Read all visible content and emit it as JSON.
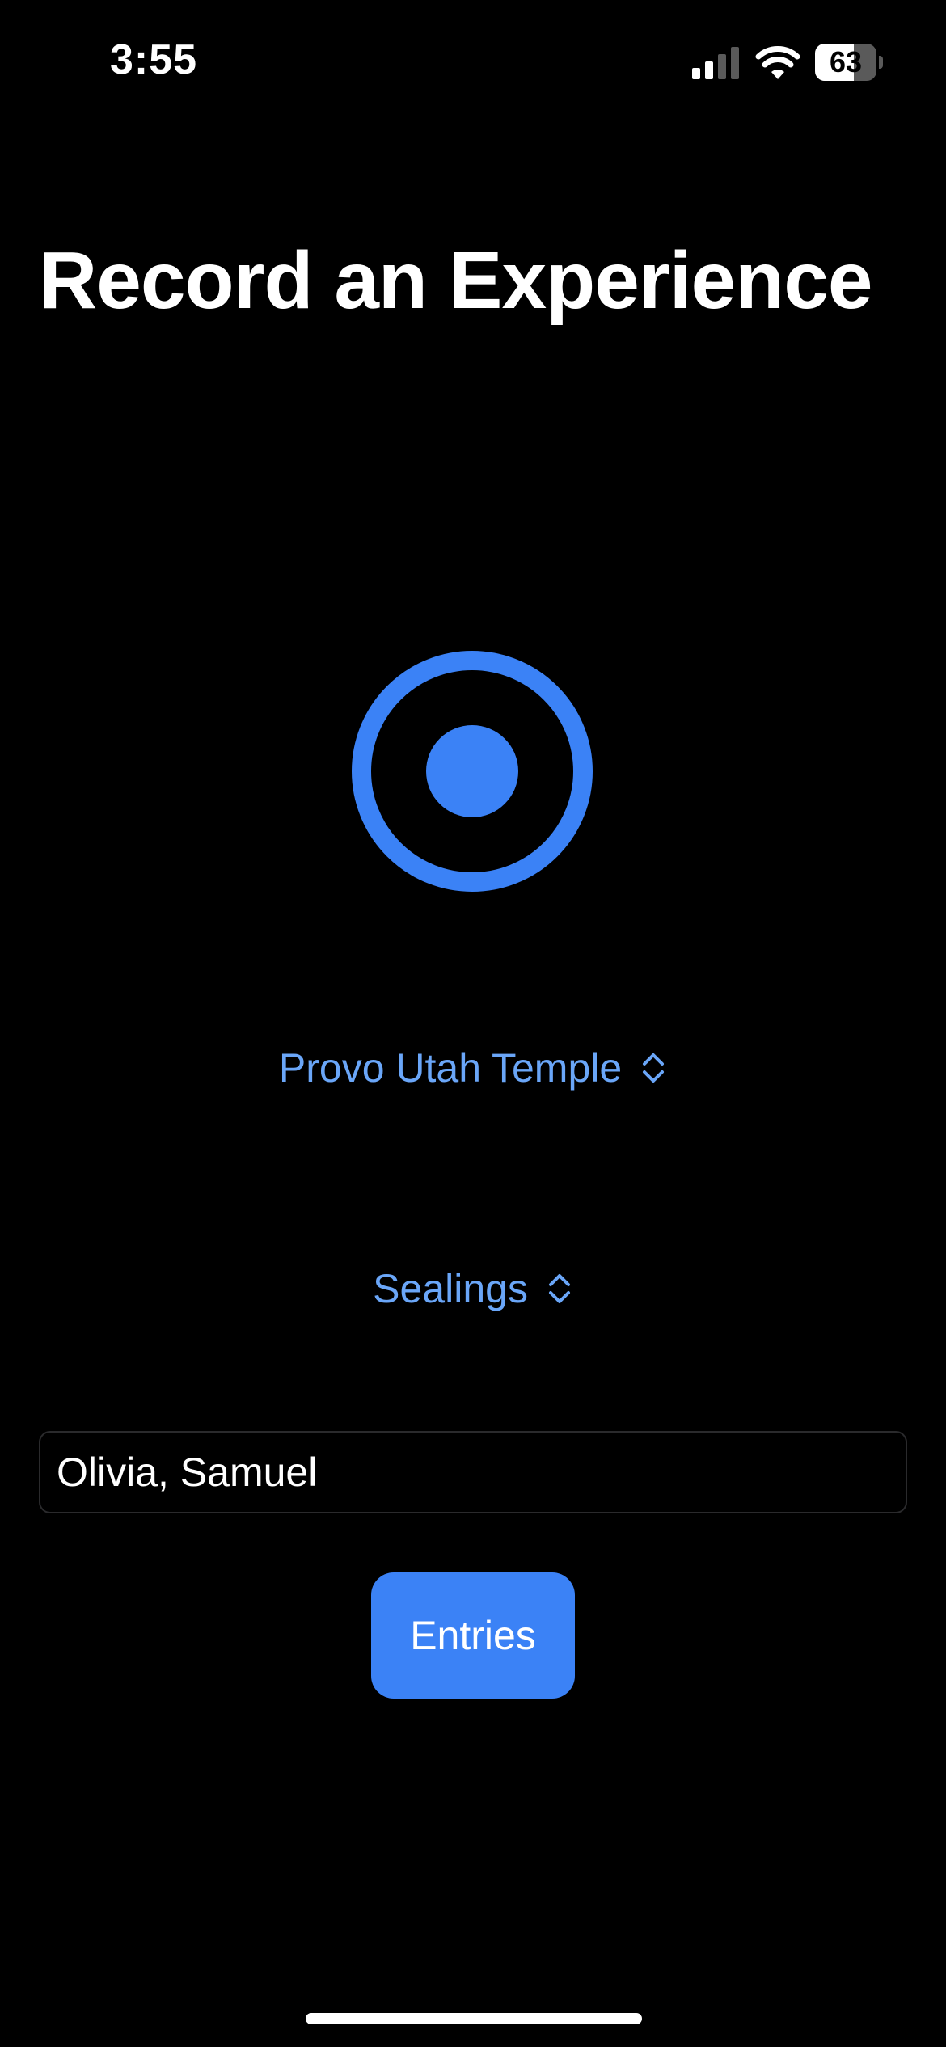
{
  "status_bar": {
    "time": "3:55",
    "battery_percent": "63",
    "battery_level": 0.63,
    "signal_bars_active": 2,
    "signal_bars_total": 4
  },
  "header": {
    "title": "Record an Experience"
  },
  "record": {
    "icon": "record-circle-icon",
    "color": "#3b82f6"
  },
  "temple_picker": {
    "value": "Provo Utah Temple",
    "icon": "chevron-up-down-icon"
  },
  "ordinance_picker": {
    "value": "Sealings",
    "icon": "chevron-up-down-icon"
  },
  "names_field": {
    "value": "Olivia, Samuel"
  },
  "entries_button": {
    "label": "Entries"
  },
  "colors": {
    "background": "#000000",
    "accent": "#3b82f6",
    "link": "#6aa6f8",
    "text": "#ffffff"
  }
}
